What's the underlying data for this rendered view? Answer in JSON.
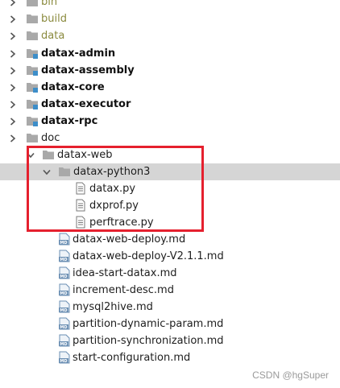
{
  "project_tree": {
    "items": [
      {
        "label": "bin",
        "kind": "excluded-folder",
        "state": "collapsed"
      },
      {
        "label": "build",
        "kind": "excluded-folder",
        "state": "collapsed"
      },
      {
        "label": "data",
        "kind": "excluded-folder",
        "state": "collapsed"
      },
      {
        "label": "datax-admin",
        "kind": "module",
        "state": "collapsed"
      },
      {
        "label": "datax-assembly",
        "kind": "module",
        "state": "collapsed"
      },
      {
        "label": "datax-core",
        "kind": "module",
        "state": "collapsed"
      },
      {
        "label": "datax-executor",
        "kind": "module",
        "state": "collapsed"
      },
      {
        "label": "datax-rpc",
        "kind": "module",
        "state": "collapsed"
      },
      {
        "label": "doc",
        "kind": "folder",
        "state": "expanded"
      },
      {
        "label": "datax-web",
        "kind": "folder",
        "state": "expanded"
      },
      {
        "label": "datax-python3",
        "kind": "folder",
        "state": "expanded",
        "selected": true
      },
      {
        "label": "datax.py",
        "kind": "text-file"
      },
      {
        "label": "dxprof.py",
        "kind": "text-file"
      },
      {
        "label": "perftrace.py",
        "kind": "text-file"
      },
      {
        "label": "datax-web-deploy.md",
        "kind": "markdown-file"
      },
      {
        "label": "datax-web-deploy-V2.1.1.md",
        "kind": "markdown-file"
      },
      {
        "label": "idea-start-datax.md",
        "kind": "markdown-file"
      },
      {
        "label": "increment-desc.md",
        "kind": "markdown-file"
      },
      {
        "label": "mysql2hive.md",
        "kind": "markdown-file"
      },
      {
        "label": "partition-dynamic-param.md",
        "kind": "markdown-file"
      },
      {
        "label": "partition-synchronization.md",
        "kind": "markdown-file"
      },
      {
        "label": "start-configuration.md",
        "kind": "markdown-file"
      }
    ],
    "md_badge": "MD"
  },
  "annotation": {
    "highlight_color": "#e5202e"
  },
  "watermark": {
    "text": "CSDN @hgSuper"
  },
  "colors": {
    "folder": "#a9a9a9",
    "folder_module_marker": "#3d8ec9",
    "excluded_text": "#8a8a3e",
    "selection": "#d5d5d5",
    "md_icon": "#6b8fb3"
  }
}
